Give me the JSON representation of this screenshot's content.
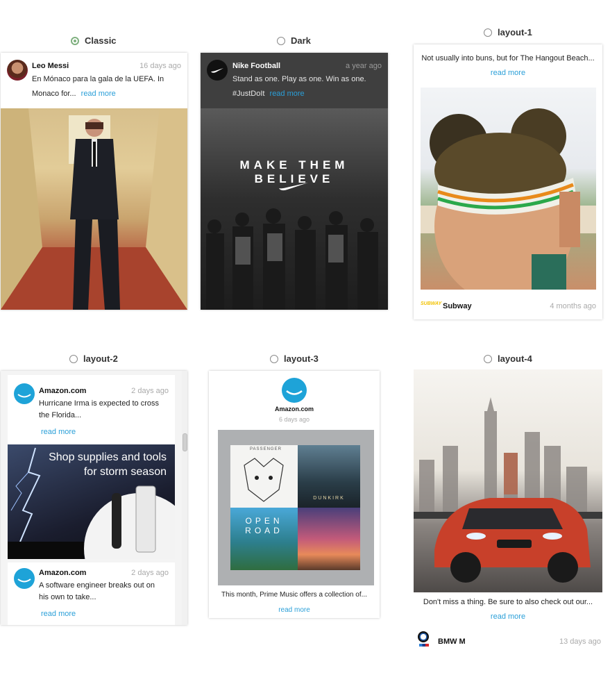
{
  "options": [
    {
      "label": "Classic",
      "checked": true
    },
    {
      "label": "Dark",
      "checked": false
    },
    {
      "label": "layout-1",
      "checked": false
    },
    {
      "label": "layout-2",
      "checked": false
    },
    {
      "label": "layout-3",
      "checked": false
    },
    {
      "label": "layout-4",
      "checked": false
    }
  ],
  "classic": {
    "name": "Leo Messi",
    "time": "16 days ago",
    "line1": "En Mónaco para la gala de la UEFA. In",
    "line2": "Monaco for...",
    "more": "read more"
  },
  "dark": {
    "name": "Nike Football",
    "time": "a year ago",
    "line1": "Stand as one. Play as one. Win as one.",
    "line2": "#JustDoIt",
    "more": "read more",
    "banner": "MAKE THEM BELIEVE"
  },
  "layout1": {
    "text": "Not usually into buns, but for The Hangout Beach...",
    "more": "read more",
    "brand_logo": "SUBWAY",
    "name": "Subway",
    "time": "4 months ago"
  },
  "layout2": {
    "posts": [
      {
        "name": "Amazon.com",
        "time": "2 days ago",
        "line1": "Hurricane Irma is expected to cross",
        "line2": "the Florida...",
        "more": "read more"
      },
      {
        "name": "Amazon.com",
        "time": "2 days ago",
        "line1": "A software engineer breaks out on",
        "line2": "his own to take...",
        "more": "read more"
      }
    ],
    "banner_line1": "Shop supplies and tools",
    "banner_line2": "for storm season"
  },
  "layout3": {
    "name": "Amazon.com",
    "time": "6 days ago",
    "albums": [
      "PASSENGER",
      "DUNKIRK",
      "OPEN ROAD",
      ""
    ],
    "text": "This month, Prime Music offers a collection of...",
    "more": "read more"
  },
  "layout4": {
    "text": "Don't miss a thing. Be sure to also check out our...",
    "more": "read more",
    "name": "BMW M",
    "time": "13 days ago"
  },
  "colors": {
    "link": "#2a9fd8",
    "radio_checked": "#7fb07f",
    "amazon_blue": "#1ea3d8",
    "dark_header": "#3f3f3f"
  }
}
